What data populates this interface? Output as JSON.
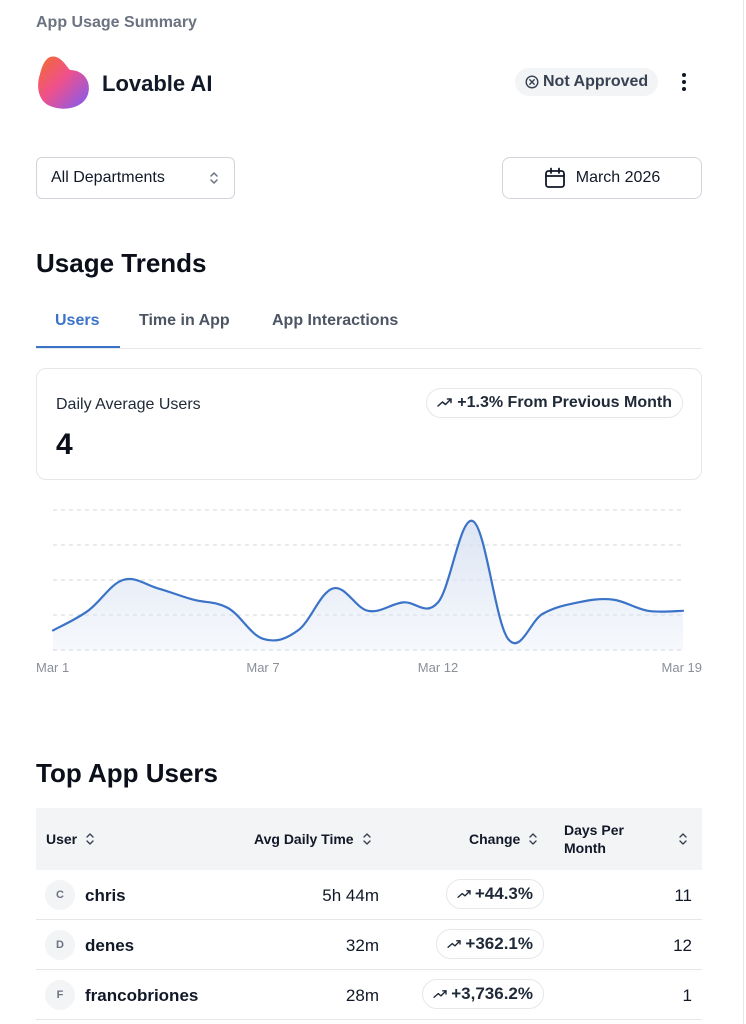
{
  "page": {
    "heading": "App Usage Summary"
  },
  "app": {
    "name": "Lovable AI",
    "status": "Not Approved"
  },
  "filters": {
    "department": "All Departments",
    "month": "March 2026"
  },
  "usage_trends": {
    "title": "Usage Trends",
    "tabs": [
      {
        "label": "Users",
        "active": true
      },
      {
        "label": "Time in App",
        "active": false
      },
      {
        "label": "App Interactions",
        "active": false
      }
    ],
    "metric": {
      "label": "Daily Average Users",
      "value": "4",
      "trend": "+1.3% From Previous Month"
    }
  },
  "chart_data": {
    "type": "area",
    "x": [
      "Mar 1",
      "Mar 2",
      "Mar 3",
      "Mar 4",
      "Mar 5",
      "Mar 6",
      "Mar 7",
      "Mar 8",
      "Mar 9",
      "Mar 10",
      "Mar 11",
      "Mar 12",
      "Mar 13",
      "Mar 14",
      "Mar 15",
      "Mar 16",
      "Mar 17",
      "Mar 18",
      "Mar 19"
    ],
    "x_tick_labels": [
      "Mar 1",
      "Mar 7",
      "Mar 12",
      "Mar 19"
    ],
    "values": [
      3.7,
      4.4,
      5.5,
      5.2,
      4.8,
      4.5,
      3.4,
      3.7,
      5.2,
      4.4,
      4.7,
      4.7,
      7.6,
      3.4,
      4.3,
      4.7,
      4.8,
      4.4,
      4.4
    ],
    "ylim": [
      3,
      8
    ],
    "grid": true,
    "color": "#3b73c8",
    "fill": "#dbe4f3"
  },
  "top_users": {
    "title": "Top App Users",
    "columns": {
      "user": "User",
      "avg_daily_time": "Avg Daily Time",
      "change": "Change",
      "days_per_month": "Days Per Month"
    },
    "rows": [
      {
        "initial": "C",
        "name": "chris",
        "avg_daily_time": "5h 44m",
        "change": "+44.3%",
        "days": "11"
      },
      {
        "initial": "D",
        "name": "denes",
        "avg_daily_time": "32m",
        "change": "+362.1%",
        "days": "12"
      },
      {
        "initial": "F",
        "name": "francobriones",
        "avg_daily_time": "28m",
        "change": "+3,736.2%",
        "days": "1"
      }
    ]
  }
}
